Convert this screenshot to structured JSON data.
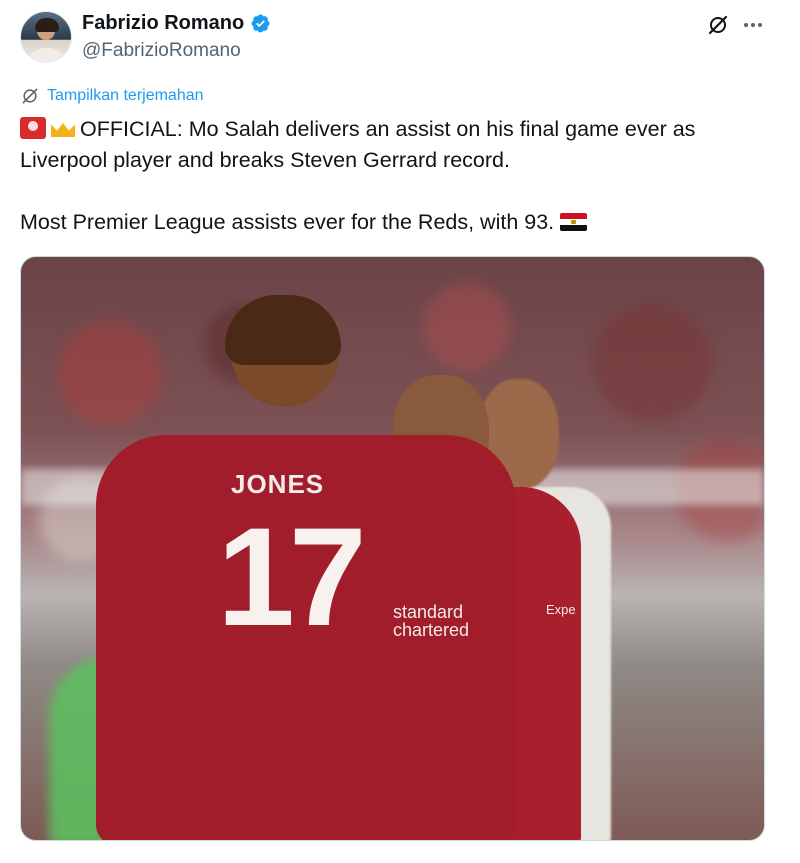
{
  "author": {
    "display_name": "Fabrizio Romano",
    "handle": "@FabrizioRomano",
    "verified": true
  },
  "actions": {
    "grok_icon": "grok-icon",
    "more_icon": "more-options-icon"
  },
  "translate": {
    "label": "Tampilkan terjemahan"
  },
  "tweet": {
    "line1": "OFFICIAL: Mo Salah delivers an assist on his final game ever as Liverpool player and breaks Steven Gerrard record.",
    "line2": "Most Premier League assists ever for the Reds, with 93.",
    "emojis": [
      "rotating-light-emoji",
      "crown-emoji",
      "egypt-flag-emoji"
    ]
  },
  "media": {
    "jersey_name": "JONES",
    "jersey_number": "17",
    "sponsor_line1": "standard",
    "sponsor_line2": "chartered",
    "sleeve_sponsor": "Expe"
  },
  "colors": {
    "link": "#1d9bf0",
    "verified": "#1d9bf0",
    "text": "#0f1419",
    "muted": "#536471"
  }
}
